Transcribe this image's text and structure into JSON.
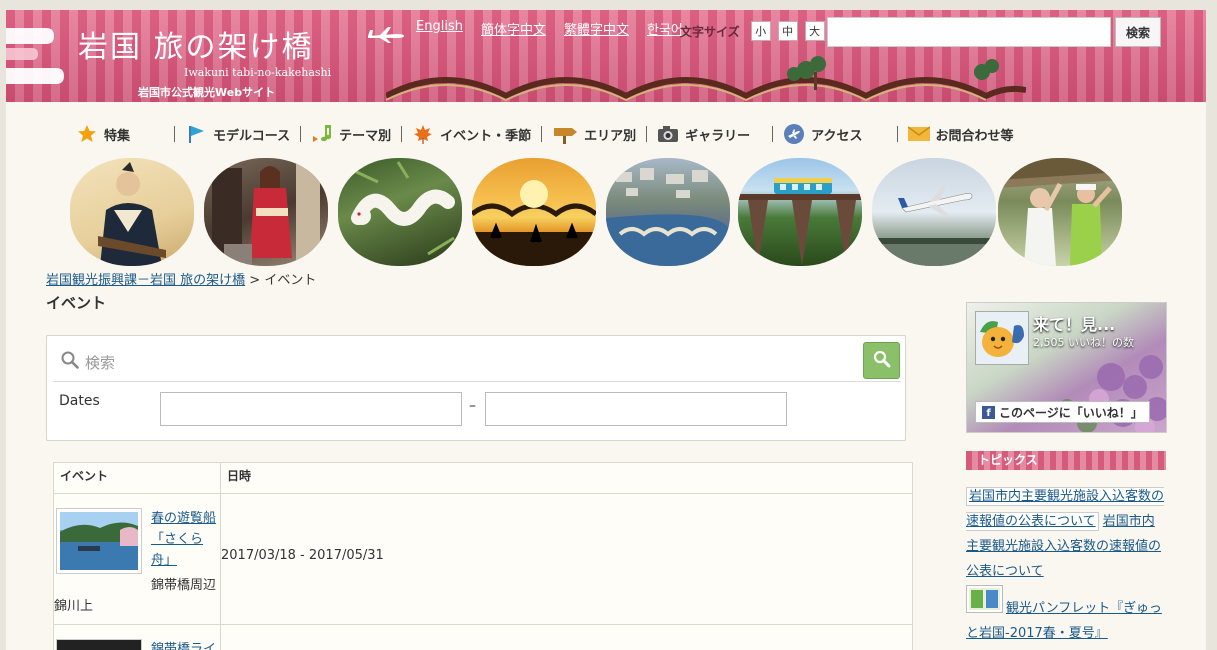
{
  "header": {
    "logo_line": "岩国 旅の架け橋",
    "logo_roman": "Iwakuni tabi-no-kakehashi",
    "logo_sub": "岩国市公式観光Webサイト",
    "languages": [
      "English",
      "簡体字中文",
      "繁體字中文",
      "한국어"
    ],
    "font_size_label": "文字サイズ",
    "font_sizes": [
      "小",
      "中",
      "大"
    ],
    "search_value": "",
    "search_button": "検索"
  },
  "main_nav": [
    {
      "label": "特集",
      "icon": "star-icon"
    },
    {
      "label": "モデルコース",
      "icon": "flag-icon"
    },
    {
      "label": "テーマ別",
      "icon": "music-note-icon"
    },
    {
      "label": "イベント・季節",
      "icon": "maple-leaf-icon"
    },
    {
      "label": "エリア別",
      "icon": "signpost-icon"
    },
    {
      "label": "ギャラリー",
      "icon": "camera-icon"
    },
    {
      "label": "アクセス",
      "icon": "airplane-icon"
    },
    {
      "label": "お問合わせ等",
      "icon": "envelope-icon"
    }
  ],
  "photos": [
    "samurai-portrait-photo",
    "kimono-woman-photo",
    "white-snake-photo",
    "bridge-sunset-photo",
    "bridge-aerial-photo",
    "train-bridge-photo",
    "airport-plane-photo",
    "guide-photo"
  ],
  "breadcrumb": {
    "link": "岩国観光振興課－岩国 旅の架け橋",
    "separator": ">",
    "current": "イベント"
  },
  "page_title": "イベント",
  "search": {
    "placeholder": "検索",
    "dates_label": "Dates",
    "date_from": "",
    "date_separator": "–",
    "date_to": ""
  },
  "events_table": {
    "headers": [
      "イベント",
      "日時"
    ],
    "rows": [
      {
        "title": "春の遊覧船 「さくら舟」",
        "place_line1": "錦帯橋周辺",
        "place_line2": "錦川上",
        "date": "2017/03/18 - 2017/05/31"
      },
      {
        "title": "錦帯橋ライ",
        "place_line1": "",
        "place_line2": "",
        "date": ""
      }
    ]
  },
  "facebook": {
    "page_name": "来て！見...",
    "likes": "2,505 いいね！の数",
    "like_button": "このページに「いいね！」"
  },
  "topics": {
    "heading": "トピックス",
    "item1_boxed": "岩国市内主要観光施設入込客数の速報値の公表について",
    "item1_plain": "岩国市内主要観光施設入込客数の速報値の公表について",
    "item2": "観光パンフレット『ぎゅっと岩国-2017春・夏号』"
  },
  "colors": {
    "header_pink": "#d9587c",
    "header_pink_light": "#e7809c",
    "link_blue": "#1a5a8a",
    "search_green": "#8ac06a",
    "page_bg": "#faf7f0"
  }
}
